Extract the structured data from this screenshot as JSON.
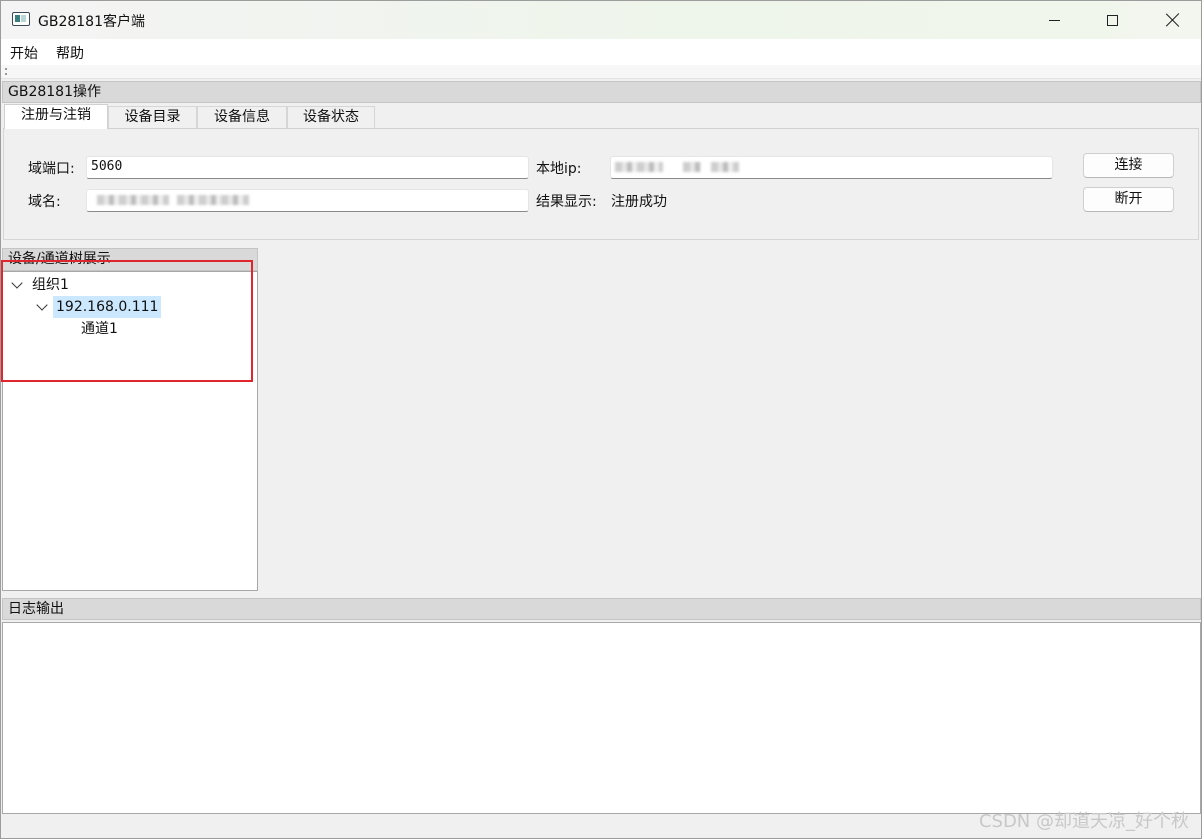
{
  "window": {
    "title": "GB28181客户端"
  },
  "menu": {
    "items": [
      "开始",
      "帮助"
    ]
  },
  "ops_dock": {
    "title": "GB28181操作",
    "tabs": [
      "注册与注销",
      "设备目录",
      "设备信息",
      "设备状态"
    ],
    "active_tab": "注册与注销",
    "domain_port_label": "域端口:",
    "domain_port_value": "5060",
    "local_ip_label": "本地ip:",
    "domain_name_label": "域名:",
    "result_label": "结果显示:",
    "result_value": "注册成功",
    "connect_button": "连接",
    "disconnect_button": "断开"
  },
  "tree_dock": {
    "title": "设备/通道树展示",
    "nodes": [
      {
        "label": "组织1",
        "expanded": true
      },
      {
        "label": "192.168.0.111",
        "expanded": true,
        "selected": true
      },
      {
        "label": "通道1"
      }
    ]
  },
  "log_dock": {
    "title": "日志输出"
  },
  "watermark": "CSDN @却道天凉_好个秋",
  "colors": {
    "highlight_box": "#e0262c",
    "selection": "#cce8ff"
  }
}
